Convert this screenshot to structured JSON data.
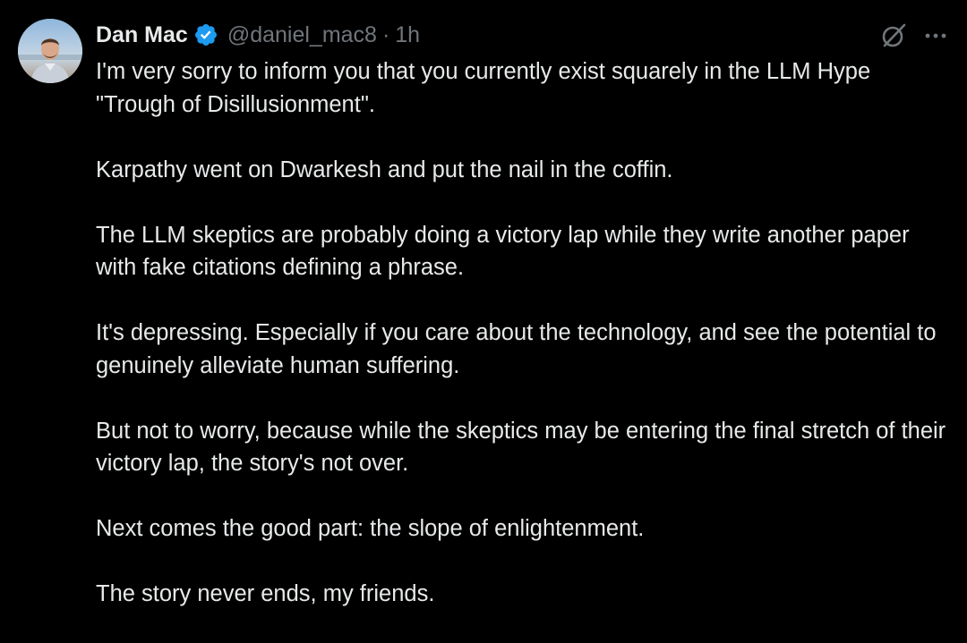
{
  "post": {
    "author": {
      "display_name": "Dan Mac",
      "handle": "@daniel_mac8",
      "verified": true,
      "avatar": "profile-photo"
    },
    "separator": "·",
    "time": "1h",
    "icons": {
      "grok": "grok-icon",
      "more": "more-icon"
    },
    "paragraphs": [
      "I'm very sorry to inform you that you currently exist squarely in the LLM Hype \"Trough of Disillusionment\".",
      "Karpathy went on Dwarkesh and put the nail in the coffin.",
      "The LLM skeptics are probably doing a victory lap while they write another paper with fake citations defining a phrase.",
      "It's depressing. Especially if you care about the technology, and see the potential to genuinely alleviate human suffering.",
      "But not to worry, because while the skeptics may be entering the final stretch of their victory lap, the story's not over.",
      "Next comes the good part: the slope of enlightenment.",
      "The story never ends, my friends."
    ]
  },
  "colors": {
    "background": "#000000",
    "text": "#e7e9ea",
    "secondary_text": "#71767b",
    "verified_badge": "#1d9bf0"
  }
}
